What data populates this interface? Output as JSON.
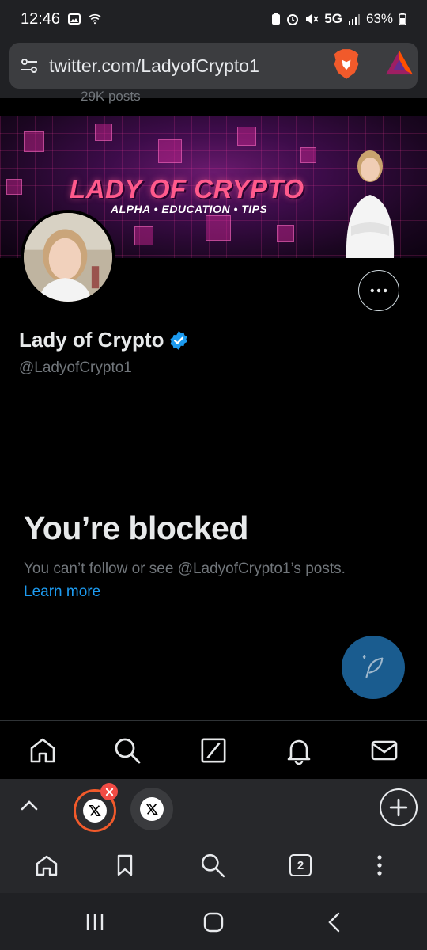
{
  "status_bar": {
    "time": "12:46",
    "network": "5G",
    "battery": "63%"
  },
  "browser": {
    "url": "twitter.com/LadyofCrypto1",
    "tab_count": "2"
  },
  "profile": {
    "posts_count": "29K posts",
    "banner_title": "LADY OF CRYPTO",
    "banner_subtitle": "ALPHA • EDUCATION • TIPS",
    "display_name": "Lady of Crypto",
    "handle": "@LadyofCrypto1",
    "verified": true
  },
  "blocked": {
    "title": "You’re blocked",
    "message": "You can’t follow or see @LadyofCrypto1’s posts.",
    "link": "Learn more"
  },
  "colors": {
    "accent": "#1d9bf0",
    "brave_orange": "#f15a2b",
    "fab": "#1a5c8f"
  }
}
